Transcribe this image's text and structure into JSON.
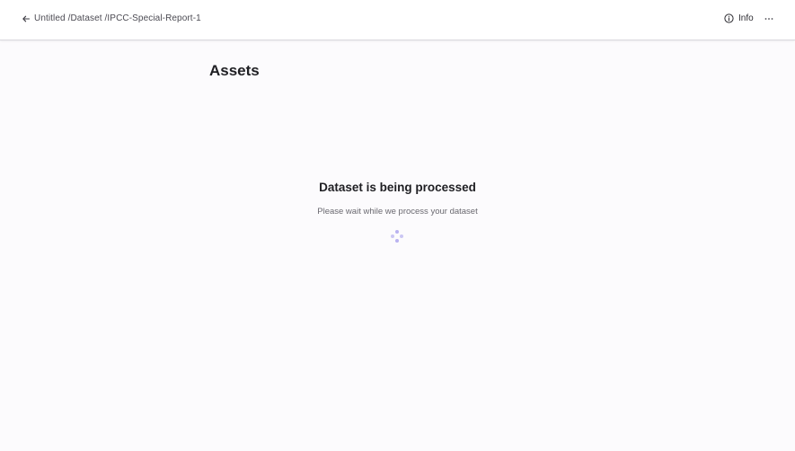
{
  "header": {
    "back_icon": "arrow-left-icon",
    "breadcrumb": [
      "Untitled",
      "/Dataset",
      "/IPCC-Special-Report-1"
    ],
    "info_label": "Info",
    "info_icon": "info-circle-icon",
    "more_icon": "more-horizontal-icon"
  },
  "main": {
    "title": "Assets",
    "status": {
      "title": "Dataset is being processed",
      "subtitle": "Please wait while we process your dataset",
      "spinner_icon": "loading-spinner-icon"
    }
  },
  "colors": {
    "background": "#fcfbfd",
    "topbar": "#ffffff",
    "spinner": "#b9b2f0"
  }
}
